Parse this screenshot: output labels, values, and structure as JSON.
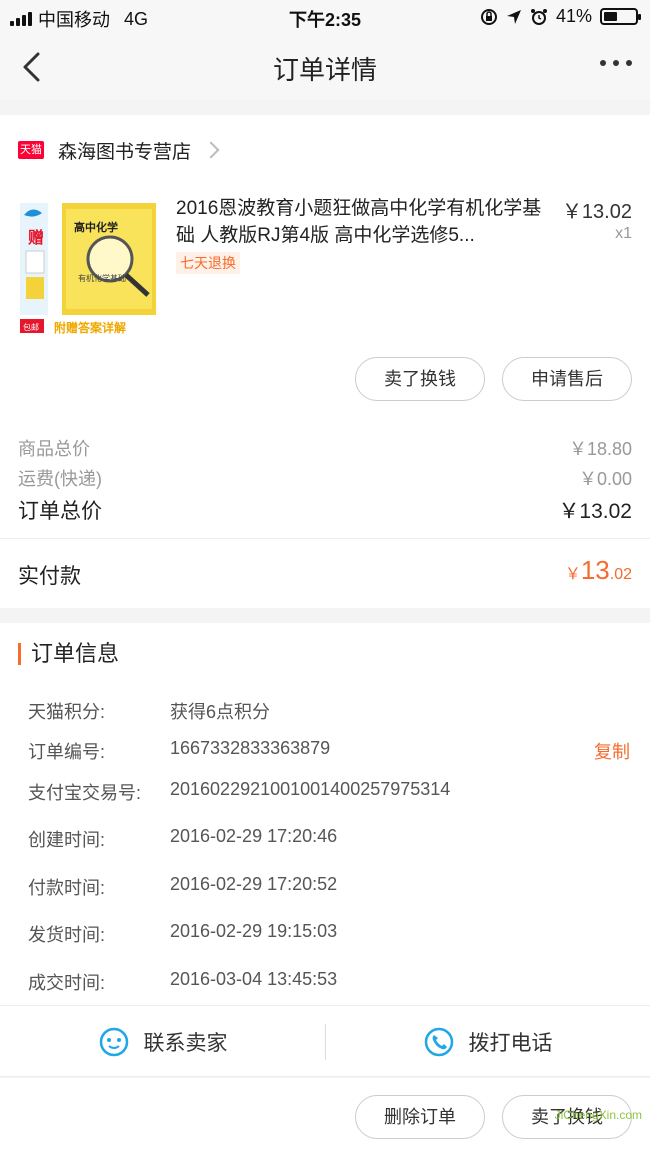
{
  "status_bar": {
    "carrier": "中国移动",
    "network": "4G",
    "time": "下午2:35",
    "battery": "41%",
    "battery_level": 0.41
  },
  "nav": {
    "title": "订单详情",
    "back_icon": "chevron-left-icon",
    "more_icon": "more-dots-icon"
  },
  "shop": {
    "badge": "天猫",
    "name": "森海图书专营店"
  },
  "product": {
    "title": "2016恩波教育小题狂做高中化学有机化学基础 人教版RJ第4版 高中化学选修5...",
    "price": "￥13.02",
    "qty": "x1",
    "return_tag": "七天退换",
    "image_texts": {
      "cover_title": "高中化学",
      "cover_sub": "有机化学基础",
      "gift": "赠",
      "banner": "附赠答案详解",
      "free_ship": "包邮"
    }
  },
  "buttons": {
    "sell": "卖了换钱",
    "after_sale": "申请售后",
    "delete_order": "删除订单",
    "exchange": "卖了换钱"
  },
  "summary": {
    "goods_total_label": "商品总价",
    "goods_total": "￥18.80",
    "shipping_label": "运费(快递)",
    "shipping": "￥0.00",
    "order_total_label": "订单总价",
    "order_total": "￥13.02",
    "paid_label": "实付款",
    "paid_currency": "￥",
    "paid_int": "13",
    "paid_dec": ".02"
  },
  "info": {
    "title": "订单信息",
    "copy": "复制",
    "rows": [
      {
        "k": "天猫积分:",
        "v": "获得6点积分"
      },
      {
        "k": "订单编号:",
        "v": "1667332833363879"
      },
      {
        "k": "支付宝交易号:",
        "v": "2016022921001001400257975314"
      },
      {
        "k": "创建时间:",
        "v": "2016-02-29 17:20:46"
      },
      {
        "k": "付款时间:",
        "v": "2016-02-29 17:20:52"
      },
      {
        "k": "发货时间:",
        "v": "2016-02-29 19:15:03"
      },
      {
        "k": "成交时间:",
        "v": "2016-03-04 13:45:53"
      }
    ]
  },
  "actions": {
    "contact_seller": "联系卖家",
    "call": "拨打电话"
  },
  "watermark": "JiChengXin.com",
  "colors": {
    "accent": "#f56c2d",
    "tmall_red": "#ff0036",
    "icon_blue": "#1fa7e8"
  }
}
